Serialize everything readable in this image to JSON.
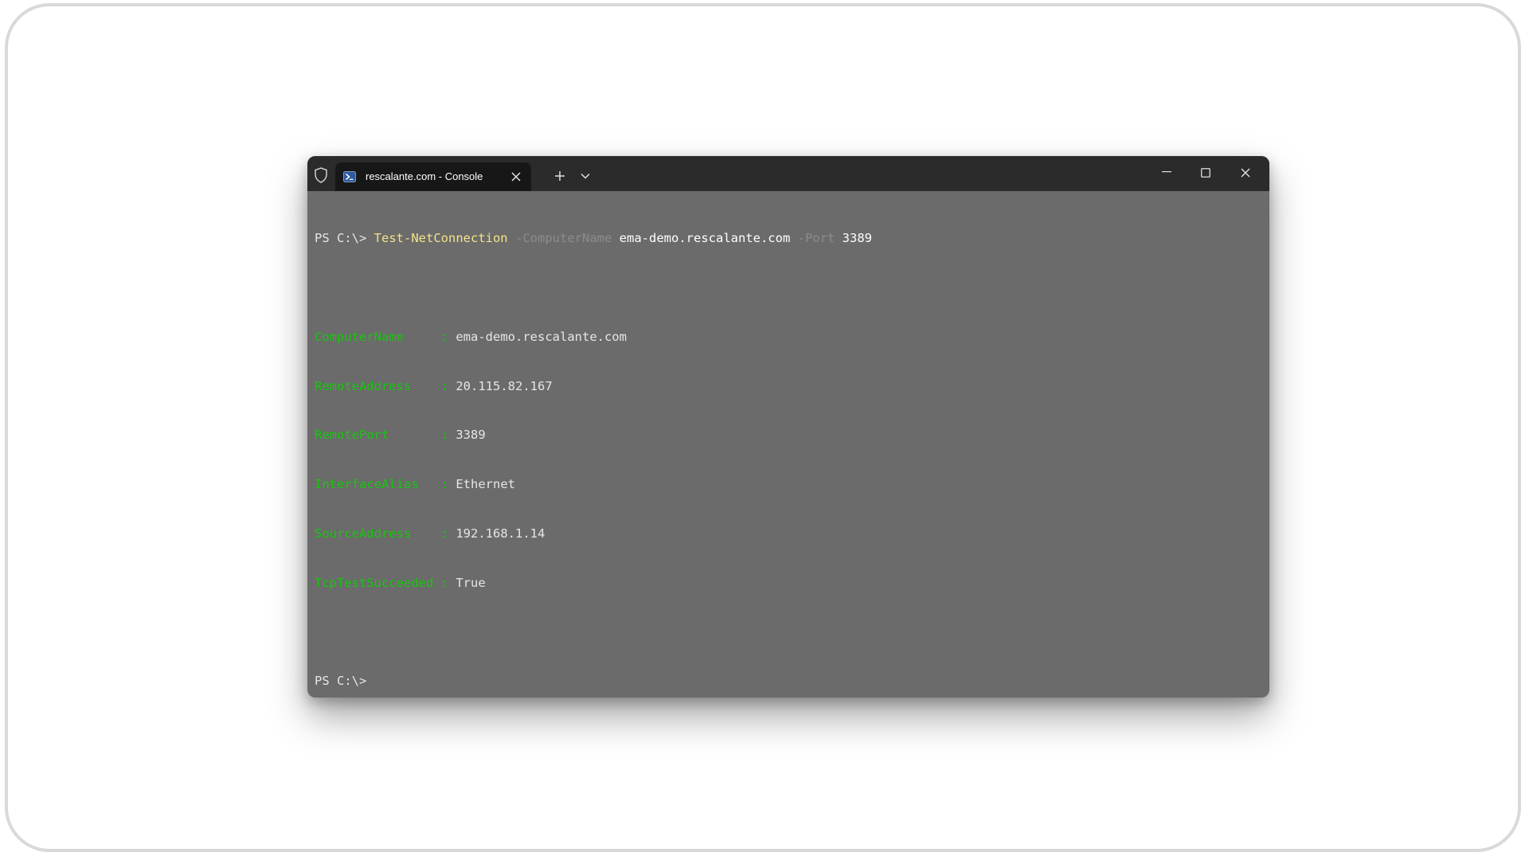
{
  "window": {
    "tab_title": "rescalante.com - Console"
  },
  "console": {
    "prompt": "PS C:\\>",
    "command": {
      "cmdlet": "Test-NetConnection",
      "param1": "-ComputerName",
      "arg1": "ema-demo.rescalante.com",
      "param2": "-Port",
      "arg2": "3389"
    },
    "output": [
      {
        "key": "ComputerName",
        "value": "ema-demo.rescalante.com"
      },
      {
        "key": "RemoteAddress",
        "value": "20.115.82.167"
      },
      {
        "key": "RemotePort",
        "value": "3389"
      },
      {
        "key": "InterfaceAlias",
        "value": "Ethernet"
      },
      {
        "key": "SourceAddress",
        "value": "192.168.1.14"
      },
      {
        "key": "TcpTestSucceeded",
        "value": "True"
      }
    ],
    "final_prompt": "PS C:\\>"
  },
  "colors": {
    "titlebar": "#2b2b2b",
    "tab_active": "#171717",
    "console_bg": "#6b6b6b",
    "cmdlet": "#f2e38a",
    "property_key": "#16c60c",
    "parameter": "#8c8c8c"
  },
  "icons": {
    "shield": "shield-icon",
    "tab": "powershell-icon",
    "tab_close": "close-icon",
    "new_tab": "plus-icon",
    "dropdown": "chevron-down-icon",
    "minimize": "minimize-icon",
    "maximize": "maximize-icon",
    "close": "close-icon"
  }
}
